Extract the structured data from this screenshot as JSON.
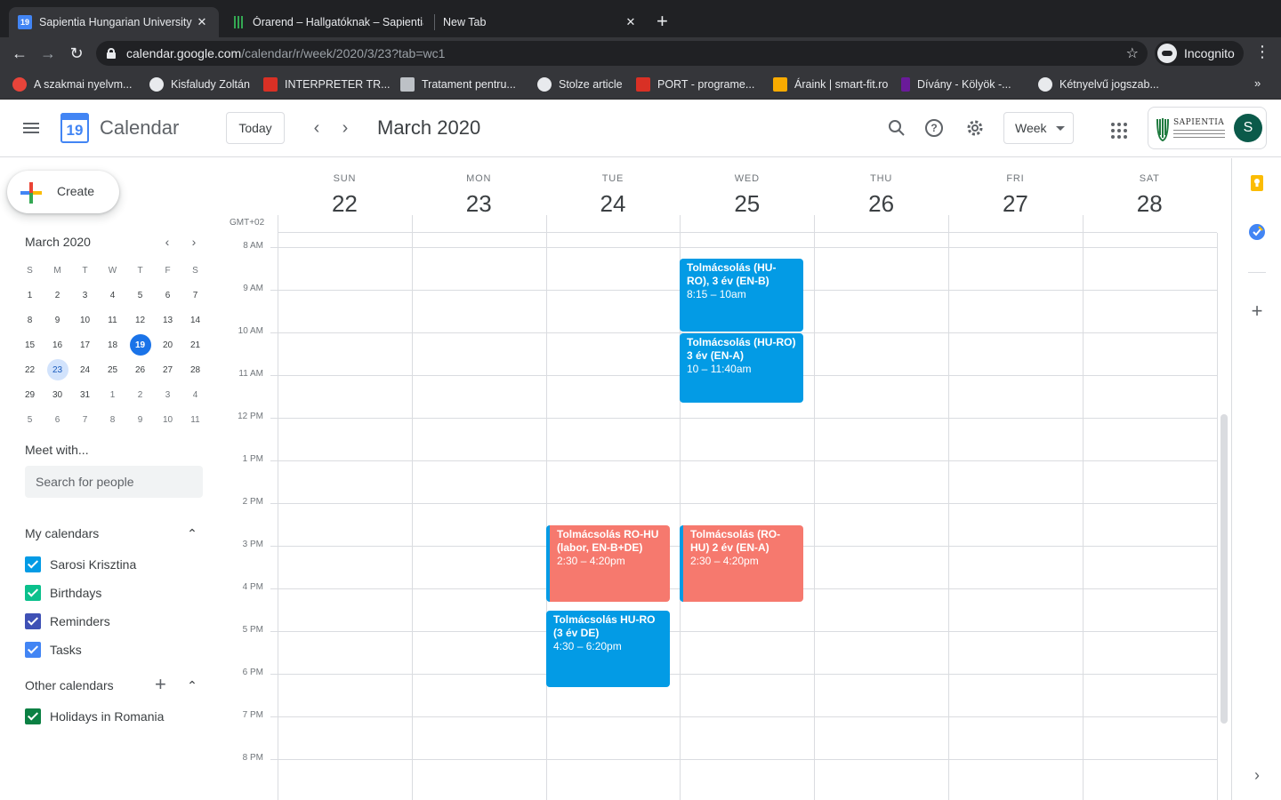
{
  "browser": {
    "tabs": [
      {
        "title": "Sapientia Hungarian University of",
        "favicon": "calendar-19-icon",
        "favicon_text": "19",
        "active": true
      },
      {
        "title": "Órarend – Hallgatóknak – Sapientia",
        "favicon": "sapientia-icon",
        "active": false
      },
      {
        "title": "New Tab",
        "favicon": "",
        "active": false
      }
    ],
    "address": {
      "host": "calendar.google.com",
      "path": "/calendar/r/week/2020/3/23?tab=wc1"
    },
    "incognito_label": "Incognito",
    "bookmarks": [
      {
        "label": "A szakmai nyelvm...",
        "icon_color": "#e8443a"
      },
      {
        "label": "Kisfaludy Zoltán",
        "icon_color": "#e8eaed"
      },
      {
        "label": "INTERPRETER TR...",
        "icon_color": "#d93025"
      },
      {
        "label": "Tratament pentru...",
        "icon_color": "#bdc1c6"
      },
      {
        "label": "Stolze article",
        "icon_color": "#e8eaed"
      },
      {
        "label": "PORT - programe...",
        "icon_color": "#d93025"
      },
      {
        "label": "Áraink | smart-fit.ro",
        "icon_color": "#f9ab00"
      },
      {
        "label": "Dívány - Kölyök -...",
        "icon_color": "#6a1b9a"
      },
      {
        "label": "Kétnyelvű jogszab...",
        "icon_color": "#e8eaed"
      }
    ],
    "bookmarks_more": "»"
  },
  "header": {
    "app_name": "Calendar",
    "logo_day": "19",
    "today_label": "Today",
    "current_period": "March 2020",
    "view_label": "Week",
    "org_name": "SAPIENTIA",
    "avatar_letter": "S",
    "accent_color": "#1a73e8"
  },
  "sidebar": {
    "create_label": "Create",
    "mini_month": "March 2020",
    "weekday_initials": [
      "S",
      "M",
      "T",
      "W",
      "T",
      "F",
      "S"
    ],
    "mini_weeks": [
      [
        "1",
        "2",
        "3",
        "4",
        "5",
        "6",
        "7"
      ],
      [
        "8",
        "9",
        "10",
        "11",
        "12",
        "13",
        "14"
      ],
      [
        "15",
        "16",
        "17",
        "18",
        "19",
        "20",
        "21"
      ],
      [
        "22",
        "23",
        "24",
        "25",
        "26",
        "27",
        "28"
      ],
      [
        "29",
        "30",
        "31",
        "1",
        "2",
        "3",
        "4"
      ],
      [
        "5",
        "6",
        "7",
        "8",
        "9",
        "10",
        "11"
      ]
    ],
    "today_date": "19",
    "selected_date": "23",
    "meet_title": "Meet with...",
    "search_placeholder": "Search for people",
    "my_calendars_title": "My calendars",
    "my_calendars": [
      {
        "name": "Sarosi Krisztina",
        "color": "#039be5"
      },
      {
        "name": "Birthdays",
        "color": "#0bc08c"
      },
      {
        "name": "Reminders",
        "color": "#3f51b5"
      },
      {
        "name": "Tasks",
        "color": "#4285f4"
      }
    ],
    "other_calendars_title": "Other calendars",
    "other_calendars": [
      {
        "name": "Holidays in Romania",
        "color": "#0b8043"
      }
    ]
  },
  "week": {
    "timezone": "GMT+02",
    "days": [
      {
        "dow": "SUN",
        "date": "22"
      },
      {
        "dow": "MON",
        "date": "23"
      },
      {
        "dow": "TUE",
        "date": "24"
      },
      {
        "dow": "WED",
        "date": "25"
      },
      {
        "dow": "THU",
        "date": "26"
      },
      {
        "dow": "FRI",
        "date": "27"
      },
      {
        "dow": "SAT",
        "date": "28"
      }
    ],
    "hours": [
      "8 AM",
      "9 AM",
      "10 AM",
      "11 AM",
      "12 PM",
      "1 PM",
      "2 PM",
      "3 PM",
      "4 PM",
      "5 PM",
      "6 PM",
      "7 PM",
      "8 PM"
    ],
    "events": [
      {
        "day": "WED",
        "title": "Tolmácsolás (HU-RO), 3 év (EN-B)",
        "time": "8:15 – 10am",
        "color": "#039be5",
        "start": 8.25,
        "end": 10.0
      },
      {
        "day": "WED",
        "title": "Tolmácsolás (HU-RO) 3 év (EN-A)",
        "time": "10 – 11:40am",
        "color": "#039be5",
        "start": 10.0,
        "end": 11.667
      },
      {
        "day": "TUE",
        "title": "Tolmácsolás RO-HU (labor, EN-B+DE)",
        "time": "2:30 – 4:20pm",
        "color": "#f6796e",
        "start": 14.5,
        "end": 16.333
      },
      {
        "day": "WED",
        "title": "Tolmácsolás (RO-HU) 2 év (EN-A)",
        "time": "2:30 – 4:20pm",
        "color": "#f6796e",
        "start": 14.5,
        "end": 16.333
      },
      {
        "day": "TUE",
        "title": "Tolmácsolás HU-RO (3 év DE)",
        "time": "4:30 – 6:20pm",
        "color": "#039be5",
        "start": 16.5,
        "end": 18.333
      }
    ]
  }
}
